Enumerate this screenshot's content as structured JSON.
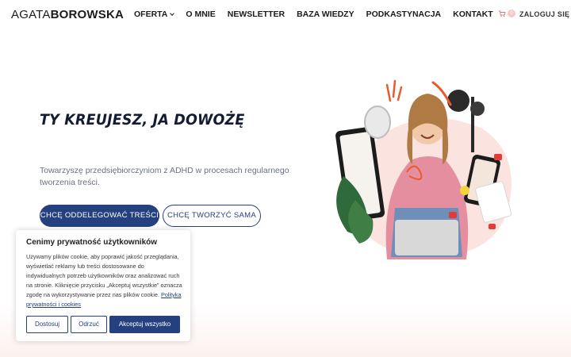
{
  "header": {
    "logo_light": "AGATA",
    "logo_bold": "BOROWSKA",
    "nav": [
      {
        "label": "OFERTA",
        "has_dropdown": true
      },
      {
        "label": "O MNIE"
      },
      {
        "label": "NEWSLETTER"
      },
      {
        "label": "BAZA WIEDZY"
      },
      {
        "label": "PODKASTYNACJA"
      },
      {
        "label": "KONTAKT"
      }
    ],
    "cart_count": "0",
    "login_label": "ZALOGUJ SIĘ"
  },
  "hero": {
    "title": "TY KREUJESZ, JA DOWOŻĘ",
    "subtitle": "Towarzyszę przedsiębiorczyniom z ADHD w procesach regularnego tworzenia treści.",
    "primary_button": "CHCĘ ODDELEGOWAĆ TREŚCI",
    "secondary_button": "CHCĘ TWORZYĆ SAMA"
  },
  "cookie": {
    "title": "Cenimy prywatność użytkowników",
    "text": "Używamy plików cookie, aby poprawić jakość przeglądania, wyświetlać reklamy lub treści dostosowane do indywidualnych potrzeb użytkowników oraz analizować ruch na stronie. Kliknięcie przycisku „Akceptuj wszystkie” oznacza zgodę na wykorzystywanie przez nas plików cookie.",
    "policy_link": "Polityka prywatności i cookies",
    "customize_label": "Dostosuj",
    "reject_label": "Odrzuć",
    "accept_label": "Akceptuj wszystko"
  },
  "colors": {
    "brand_navy": "#25407e",
    "accent_pink": "#f4c9c4",
    "band_pink": "#fdf1ee"
  },
  "icons": [
    "cart-icon",
    "chevron-down-icon"
  ]
}
